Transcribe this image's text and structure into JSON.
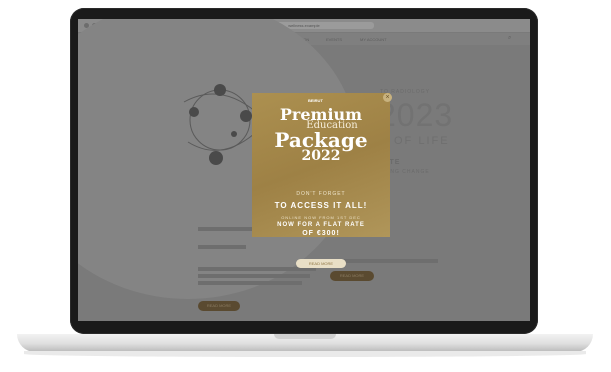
{
  "browser": {
    "url": "wellness.example"
  },
  "site": {
    "brand": "BEIRUT",
    "nav_items": [
      "HOME",
      "JEWELLERY",
      "EDUCATION",
      "EVENTS",
      "MY ACCOUNT"
    ]
  },
  "hero": {
    "kicker": "TO RADIOLOGY",
    "year": "2023",
    "subtitle": "OF LIFE",
    "heading_small": "ATE",
    "tag": "ING CHANGE"
  },
  "left_content": {
    "button_label": "READ MORE"
  },
  "right_content": {
    "button_label": "READ MORE"
  },
  "popup": {
    "close_symbol": "×",
    "logo": "BEIRUT",
    "title_line1": "Premium",
    "title_line2": "Education",
    "title_line3": "Package",
    "title_line4": "2022",
    "line_a": "DON'T FORGET",
    "line_b": "TO ACCESS IT ALL!",
    "line_c": "ONLINE NOW FROM 1ST DEC",
    "line_d": "NOW FOR A FLAT RATE",
    "line_e": "OF €300!",
    "cta": "READ MORE"
  }
}
